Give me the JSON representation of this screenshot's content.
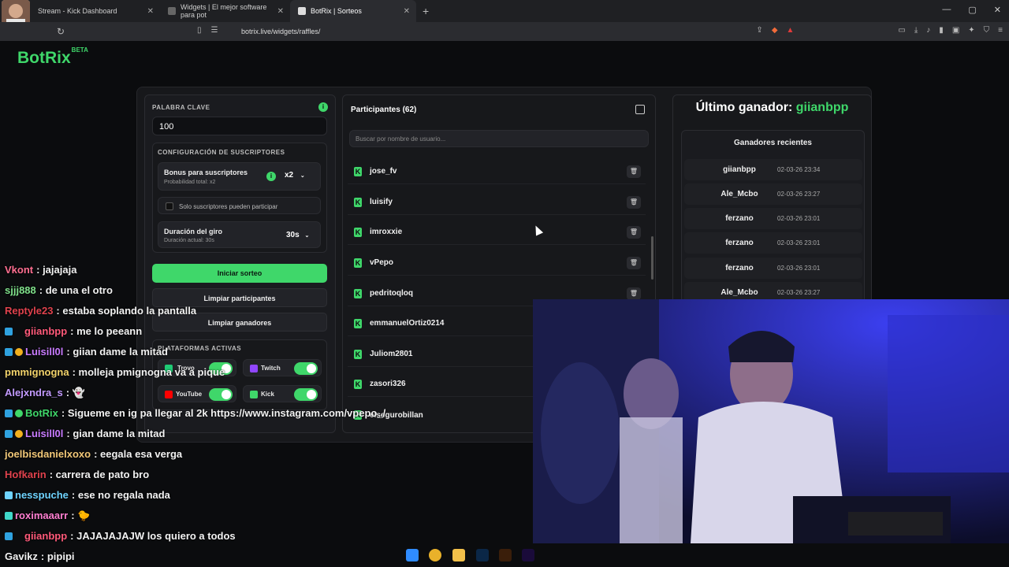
{
  "browser": {
    "tabs": [
      {
        "label": "Stream - Kick Dashboard"
      },
      {
        "label": "Widgets | El mejor software para pot"
      },
      {
        "label": "BotRix | Sorteos"
      }
    ],
    "url": "botrix.live/widgets/raffles/",
    "new_tab": "+",
    "window_controls": [
      "—",
      "▢",
      "✕"
    ]
  },
  "brand": {
    "name": "BotRix",
    "tag": "BETA"
  },
  "left_panel": {
    "keyword_label": "PALABRA CLAVE",
    "keyword_value": "100",
    "subs_config_label": "CONFIGURACIÓN DE SUSCRIPTORES",
    "bonus_title": "Bonus para suscriptores",
    "bonus_sub": "Probabilidad total: x2",
    "bonus_value": "x2",
    "subs_only_label": "Solo suscriptores pueden participar",
    "duration_title": "Duración del giro",
    "duration_sub": "Duración actual: 30s",
    "duration_value": "30s",
    "start_button": "Iniciar sorteo",
    "clear_participants": "Limpiar participantes",
    "clear_winners": "Limpiar ganadores",
    "platforms_label": "PLATAFORMAS ACTIVAS",
    "platforms": [
      {
        "name": "Trovo",
        "enabled": true
      },
      {
        "name": "Twitch",
        "enabled": true
      },
      {
        "name": "YouTube",
        "enabled": true
      },
      {
        "name": "Kick",
        "enabled": true
      }
    ]
  },
  "participants": {
    "title": "Participantes (62)",
    "search_placeholder": "Buscar por nombre de usuario...",
    "items": [
      {
        "name": "jose_fv"
      },
      {
        "name": "luisify"
      },
      {
        "name": "imroxxie"
      },
      {
        "name": "vPepo"
      },
      {
        "name": "pedritoqloq"
      },
      {
        "name": "emmanuelOrtiz0214"
      },
      {
        "name": "Juliom2801"
      },
      {
        "name": "zasori326"
      },
      {
        "name": "elsegurobillan"
      }
    ]
  },
  "winners": {
    "last_winner_prefix": "Último ganador:",
    "last_winner_name": "giianbpp",
    "recent_title": "Ganadores recientes",
    "items": [
      {
        "name": "giianbpp",
        "date": "02-03-26 23:34"
      },
      {
        "name": "Ale_Mcbo",
        "date": "02-03-26 23:27"
      },
      {
        "name": "ferzano",
        "date": "02-03-26 23:01"
      },
      {
        "name": "ferzano",
        "date": "02-03-26 23:01"
      },
      {
        "name": "ferzano",
        "date": "02-03-26 23:01"
      },
      {
        "name": "Ale_Mcbo",
        "date": "02-03-26 23:27"
      }
    ]
  },
  "chat": [
    {
      "user": "Vkont",
      "color": "#ff6f91",
      "msg": ": jajajaja"
    },
    {
      "user": "sjjj888",
      "color": "#7fe08a",
      "msg": ": de una el otro"
    },
    {
      "user": "Reptyle23",
      "color": "#e0424d",
      "msg": ": estaba soplando la pantalla"
    },
    {
      "user": "giianbpp",
      "color": "#ff5a7a",
      "msg": ": me lo peeann"
    },
    {
      "user": "Luisill0l",
      "color": "#c87bff",
      "msg": ": giian dame la mitad"
    },
    {
      "user": "pmmignogna",
      "color": "#f2d36b",
      "msg": ": molleja pmignogna va a pique"
    },
    {
      "user": "Alejxndra_s",
      "color": "#c39bff",
      "msg": ": 👻"
    },
    {
      "user": "BotRix",
      "color": "#3fd76a",
      "msg": ": Sigueme en ig pa llegar al 2k https://www.instagram.com/vpepo_/"
    },
    {
      "user": "Luisill0l",
      "color": "#c87bff",
      "msg": ": gian dame la mitad"
    },
    {
      "user": "joelbisdanielxoxo",
      "color": "#f2c878",
      "msg": ": eegala esa verga"
    },
    {
      "user": "Hofkarin",
      "color": "#e0424d",
      "msg": ": carrera de pato bro"
    },
    {
      "user": "nesspuche",
      "color": "#6fd4ff",
      "msg": ": ese no regala nada"
    },
    {
      "user": "roximaaarr",
      "color": "#ff7fd1",
      "msg": ": 🐤"
    },
    {
      "user": "giianbpp",
      "color": "#ff5a7a",
      "msg": ": JAJAJAJAJW los quiero a todos"
    },
    {
      "user": "Gavikz",
      "color": "#f2f2f2",
      "msg": ": pipipi"
    }
  ],
  "colors": {
    "accent": "#3fd76a",
    "bg": "#0b0c0e"
  }
}
